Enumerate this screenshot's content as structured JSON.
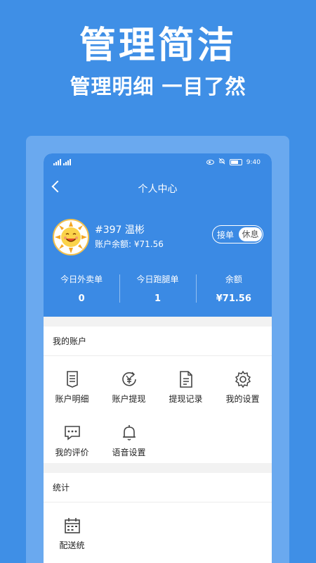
{
  "promo": {
    "title": "管理简洁",
    "subtitle": "管理明细 一目了然"
  },
  "status_bar": {
    "time": "9:40",
    "icons": [
      "signal-icon",
      "signal-icon",
      "eye-icon",
      "bell-slash-icon",
      "battery-icon"
    ]
  },
  "nav": {
    "title": "个人中心",
    "back_icon": "chevron-left-icon"
  },
  "profile": {
    "name": "#397 温彬",
    "balance_label": "账户余额:",
    "balance_value": "¥71.56",
    "toggle_on_label": "接单",
    "toggle_off_label": "休息",
    "avatar_icon": "sun-avatar"
  },
  "stats": [
    {
      "label": "今日外卖单",
      "value": "0"
    },
    {
      "label": "今日跑腿单",
      "value": "1"
    },
    {
      "label": "余额",
      "value": "¥71.56"
    }
  ],
  "account": {
    "title": "我的账户",
    "items": [
      {
        "label": "账户明细",
        "icon": "document-icon"
      },
      {
        "label": "账户提现",
        "icon": "yen-coin-icon"
      },
      {
        "label": "提现记录",
        "icon": "file-text-icon"
      },
      {
        "label": "我的设置",
        "icon": "gear-icon"
      },
      {
        "label": "我的评价",
        "icon": "chat-bubble-icon"
      },
      {
        "label": "语音设置",
        "icon": "bell-icon"
      }
    ]
  },
  "statistics": {
    "title": "统计",
    "items": [
      {
        "label": "配送统",
        "icon": "calendar-icon"
      }
    ]
  },
  "colors": {
    "background": "#3f8fe6",
    "header": "#3b8ae4",
    "frame": "#6aa9ef"
  }
}
